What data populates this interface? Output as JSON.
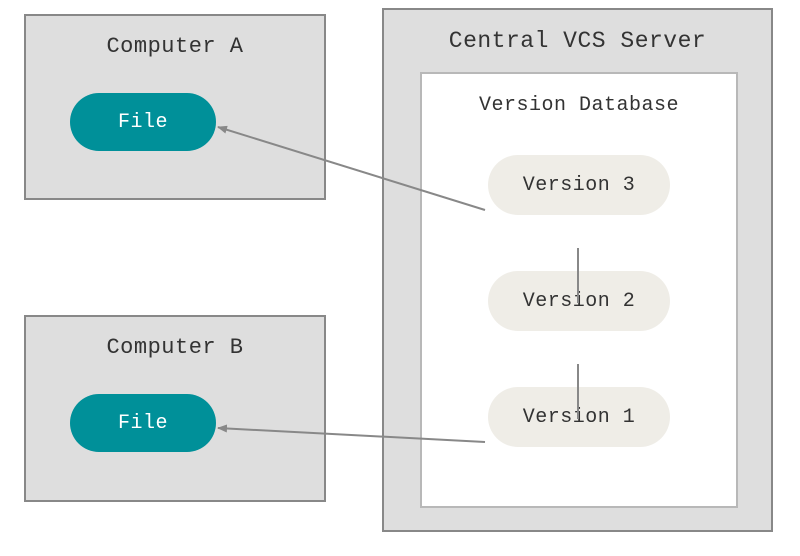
{
  "computer_a": {
    "title": "Computer A",
    "file_label": "File"
  },
  "computer_b": {
    "title": "Computer B",
    "file_label": "File"
  },
  "server": {
    "title": "Central VCS Server",
    "database": {
      "title": "Version Database",
      "versions": {
        "v3": "Version 3",
        "v2": "Version 2",
        "v1": "Version 1"
      }
    }
  }
}
